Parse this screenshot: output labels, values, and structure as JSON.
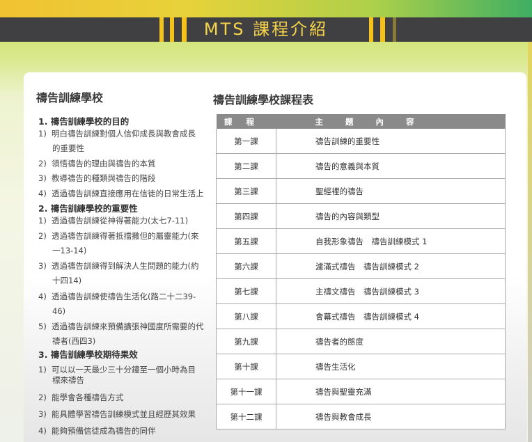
{
  "banner": {
    "title": "MTS 課程介紹"
  },
  "left": {
    "title": "禱告訓練學校",
    "sections": [
      {
        "heading": "1.  禱告訓練學校的目的",
        "items": [
          {
            "num": "1)",
            "lines": [
              "明白禱告訓練對個人信仰成長與教會成長",
              "的重要性"
            ]
          },
          {
            "num": "2)",
            "lines": [
              "領悟禱告的理由與禱告的本質"
            ]
          },
          {
            "num": "3)",
            "lines": [
              "教導禱告的種類與禱告的階段"
            ]
          },
          {
            "num": "4)",
            "lines": [
              "透過禱告訓練直接應用在信徒的日常生活上"
            ]
          }
        ]
      },
      {
        "heading": "2.  禱告訓練學校的重要性",
        "items": [
          {
            "num": "1)",
            "lines": [
              "透過禱告訓練從神得著能力(太七7-11)"
            ]
          },
          {
            "num": "2)",
            "lines": [
              "透過禱告訓練得著抵擋撒但的屬靈能力(來",
              "一13-14)"
            ]
          },
          {
            "num": "3)",
            "lines": [
              "透過禱告訓練得到解決人生問題的能力(約",
              "十四14)"
            ]
          },
          {
            "num": "4)",
            "lines": [
              "透過禱告訓練使禱告生活化(路二十二39-",
              "46)"
            ]
          },
          {
            "num": "5)",
            "lines": [
              "透過禱告訓練來預備擴張神國度所需要的代",
              "禱者(西四3)"
            ]
          }
        ]
      },
      {
        "heading": "3.  禱告訓練學校期待果效",
        "items": [
          {
            "num": "1)",
            "lines": [
              "可以以一天最少三十分鐘至一個小時為目",
              "標來禱告"
            ]
          },
          {
            "num": "2)",
            "lines": [
              "能學會各種禱告方式"
            ]
          },
          {
            "num": "3)",
            "lines": [
              "能具體學習禱告訓練模式並且經歷其效果"
            ]
          },
          {
            "num": "4)",
            "lines": [
              "能夠預備信徒成為禱告的同伴"
            ]
          }
        ]
      }
    ]
  },
  "right": {
    "title": "禱告訓練學校課程表",
    "table": {
      "headers": [
        "課程",
        "主題內容"
      ],
      "rows": [
        [
          "第一課",
          "禱告訓練的重要性"
        ],
        [
          "第二課",
          "禱告的意義與本質"
        ],
        [
          "第三課",
          "聖經裡的禱告"
        ],
        [
          "第四課",
          "禱告的內容與類型"
        ],
        [
          "第五課",
          "自我形象禱告　禱告訓練模式 1"
        ],
        [
          "第六課",
          "濾滿式禱告　禱告訓練模式 2"
        ],
        [
          "第七課",
          "主禱文禱告　禱告訓練模式 3"
        ],
        [
          "第八課",
          "會幕式禱告　禱告訓練模式 4"
        ],
        [
          "第九課",
          "禱告者的態度"
        ],
        [
          "第十課",
          "禱告生活化"
        ],
        [
          "第十一課",
          "禱告與聖靈充滿"
        ],
        [
          "第十二課",
          "禱告與教會成長"
        ]
      ]
    }
  }
}
